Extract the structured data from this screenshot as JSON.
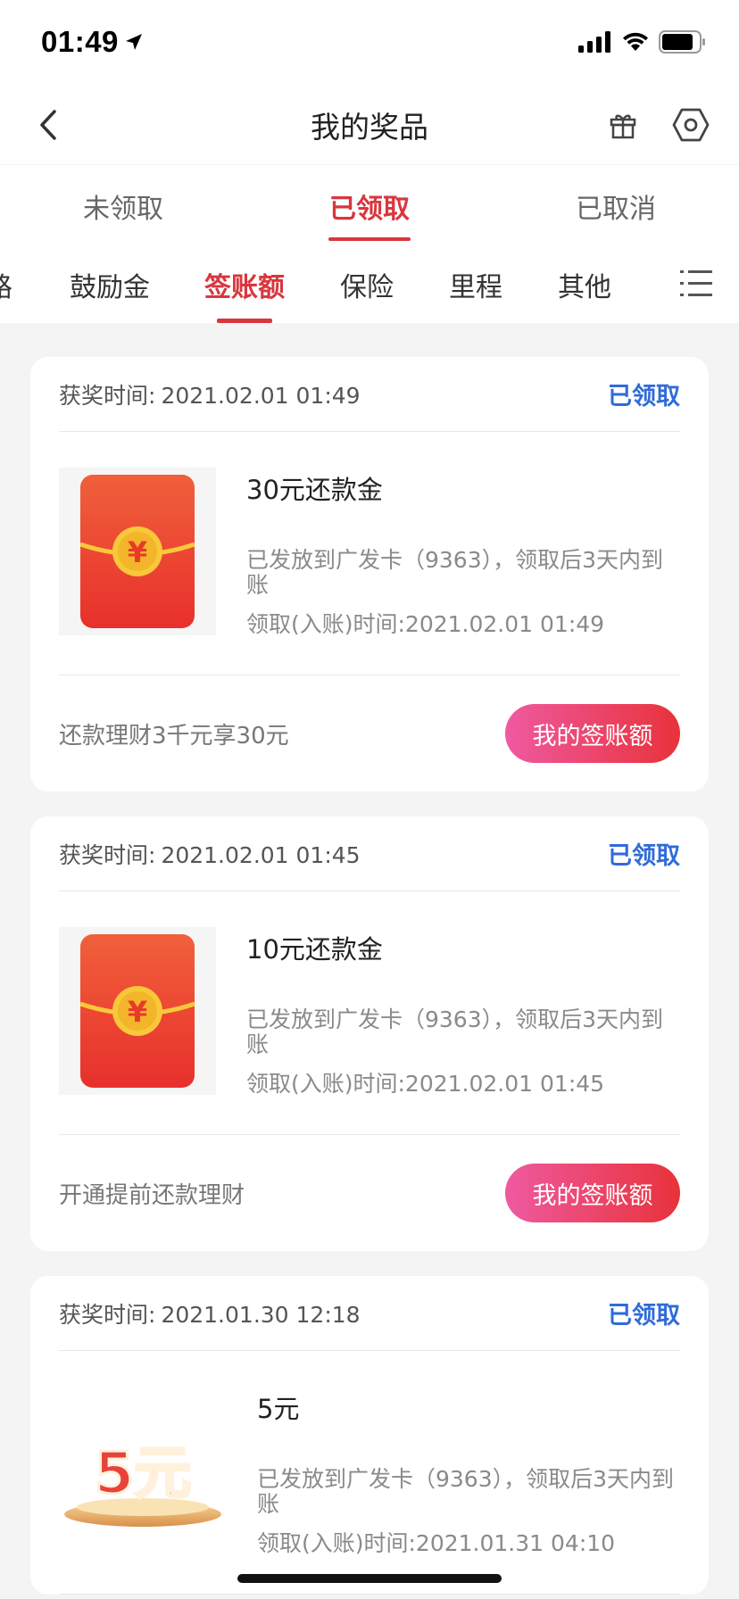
{
  "status_bar": {
    "time": "01:49"
  },
  "nav": {
    "title": "我的奖品"
  },
  "tabs": [
    {
      "label": "未领取",
      "active": false
    },
    {
      "label": "已领取",
      "active": true
    },
    {
      "label": "已取消",
      "active": false
    }
  ],
  "categories": [
    {
      "label": "路",
      "active": false
    },
    {
      "label": "鼓励金",
      "active": false
    },
    {
      "label": "签账额",
      "active": true
    },
    {
      "label": "保险",
      "active": false
    },
    {
      "label": "里程",
      "active": false
    },
    {
      "label": "其他",
      "active": false
    }
  ],
  "cards": [
    {
      "time_label": "获奖时间:",
      "time": "2021.02.01 01:49",
      "status": "已领取",
      "name": "30元还款金",
      "desc": "已发放到广发卡（9363），领取后3天内到账",
      "receive": "领取(入账)时间:2021.02.01 01:49",
      "promo": "还款理财3千元享30元",
      "button": "我的签账额",
      "image": "red-envelope-icon"
    },
    {
      "time_label": "获奖时间:",
      "time": "2021.02.01 01:45",
      "status": "已领取",
      "name": "10元还款金",
      "desc": "已发放到广发卡（9363），领取后3天内到账",
      "receive": "领取(入账)时间:2021.02.01 01:45",
      "promo": "开通提前还款理财",
      "button": "我的签账额",
      "image": "red-envelope-icon"
    },
    {
      "time_label": "获奖时间:",
      "time": "2021.01.30 12:18",
      "status": "已领取",
      "name": "5元",
      "desc": "已发放到广发卡（9363），领取后3天内到账",
      "receive": "领取(入账)时间:2021.01.31 04:10",
      "image_text": "5元",
      "image": "five-yuan-badge-icon"
    }
  ],
  "colors": {
    "accent": "#d9363e",
    "link": "#2f6bd9",
    "button_start": "#ef5aa0",
    "button_end": "#e8323a"
  }
}
